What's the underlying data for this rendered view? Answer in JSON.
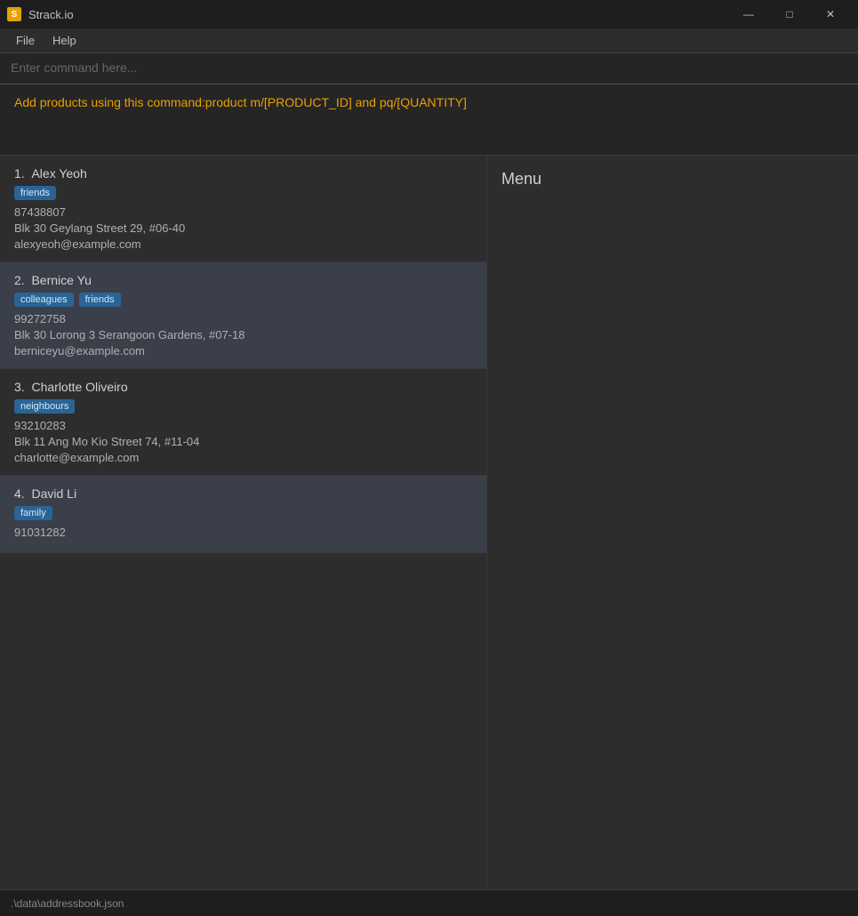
{
  "titlebar": {
    "app_name": "Strack.io",
    "icon_label": "S"
  },
  "menubar": {
    "items": [
      "File",
      "Help"
    ]
  },
  "command": {
    "placeholder": "Enter command here..."
  },
  "info": {
    "text": "Add products using this command:product m/[PRODUCT_ID] and pq/[QUANTITY]"
  },
  "contacts": [
    {
      "index": "1.",
      "name": "Alex Yeoh",
      "tags": [
        "friends"
      ],
      "phone": "87438807",
      "address": "Blk 30 Geylang Street 29, #06-40",
      "email": "alexyeoh@example.com",
      "selected": false
    },
    {
      "index": "2.",
      "name": "Bernice Yu",
      "tags": [
        "colleagues",
        "friends"
      ],
      "phone": "99272758",
      "address": "Blk 30 Lorong 3 Serangoon Gardens, #07-18",
      "email": "berniceyu@example.com",
      "selected": true
    },
    {
      "index": "3.",
      "name": "Charlotte Oliveiro",
      "tags": [
        "neighbours"
      ],
      "phone": "93210283",
      "address": "Blk 11 Ang Mo Kio Street 74, #11-04",
      "email": "charlotte@example.com",
      "selected": false
    },
    {
      "index": "4.",
      "name": "David Li",
      "tags": [
        "family"
      ],
      "phone": "91031282",
      "address": "",
      "email": "",
      "selected": true
    }
  ],
  "menu_panel": {
    "heading": "Menu"
  },
  "statusbar": {
    "text": ".\\data\\addressbook.json"
  },
  "window_controls": {
    "minimize": "—",
    "maximize": "□",
    "close": "✕"
  }
}
